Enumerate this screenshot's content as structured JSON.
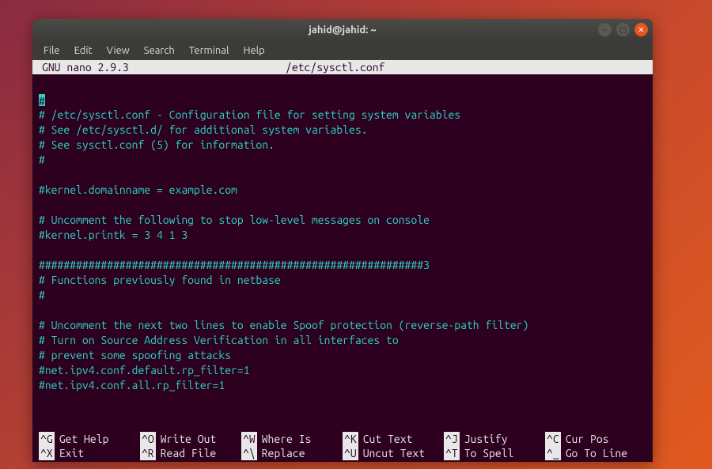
{
  "window": {
    "title": "jahid@jahid: ~"
  },
  "menu": {
    "items": [
      "File",
      "Edit",
      "View",
      "Search",
      "Terminal",
      "Help"
    ]
  },
  "nano": {
    "version_label": "  GNU nano 2.9.3",
    "filename": "/etc/sysctl.conf",
    "content_lines": [
      "",
      "CURSOR#",
      "# /etc/sysctl.conf - Configuration file for setting system variables",
      "# See /etc/sysctl.d/ for additional system variables.",
      "# See sysctl.conf (5) for information.",
      "#",
      "",
      "#kernel.domainname = example.com",
      "",
      "# Uncomment the following to stop low-level messages on console",
      "#kernel.printk = 3 4 1 3",
      "",
      "##############################################################3",
      "# Functions previously found in netbase",
      "#",
      "",
      "# Uncomment the next two lines to enable Spoof protection (reverse-path filter)",
      "# Turn on Source Address Verification in all interfaces to",
      "# prevent some spoofing attacks",
      "#net.ipv4.conf.default.rp_filter=1",
      "#net.ipv4.conf.all.rp_filter=1",
      ""
    ],
    "shortcuts_row1": [
      {
        "key": "^G",
        "label": "Get Help"
      },
      {
        "key": "^O",
        "label": "Write Out"
      },
      {
        "key": "^W",
        "label": "Where Is"
      },
      {
        "key": "^K",
        "label": "Cut Text"
      },
      {
        "key": "^J",
        "label": "Justify"
      },
      {
        "key": "^C",
        "label": "Cur Pos"
      }
    ],
    "shortcuts_row2": [
      {
        "key": "^X",
        "label": "Exit"
      },
      {
        "key": "^R",
        "label": "Read File"
      },
      {
        "key": "^\\",
        "label": "Replace"
      },
      {
        "key": "^U",
        "label": "Uncut Text"
      },
      {
        "key": "^T",
        "label": "To Spell"
      },
      {
        "key": "^_",
        "label": "Go To Line"
      }
    ]
  }
}
